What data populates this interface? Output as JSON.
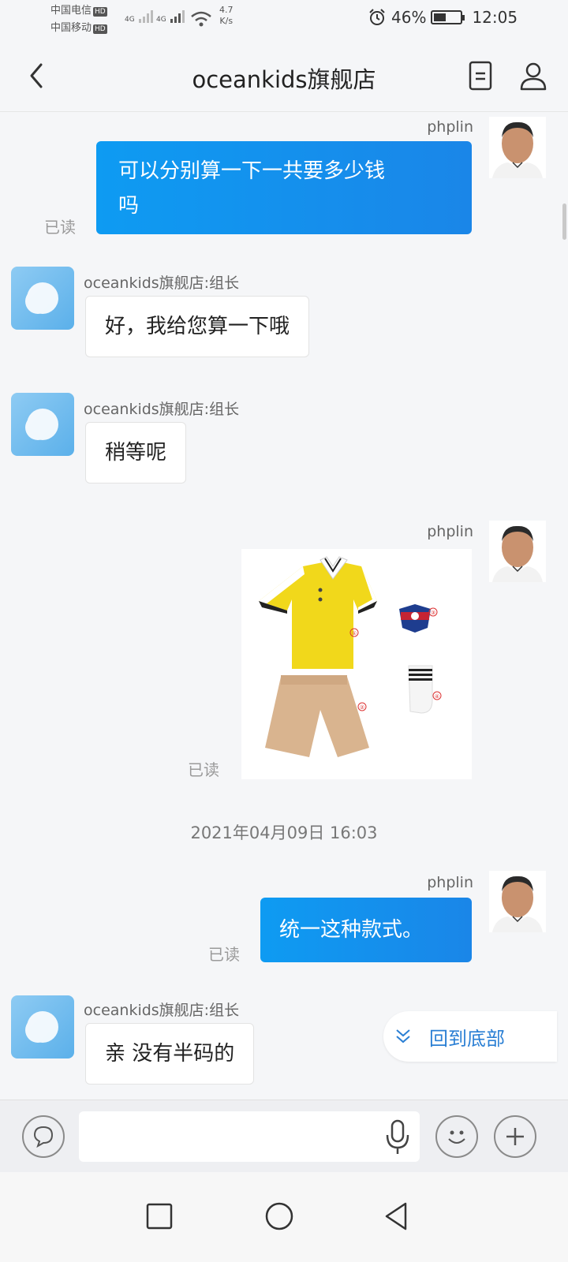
{
  "status_bar": {
    "carrier1": "中国电信",
    "carrier2": "中国移动",
    "hd": "HD",
    "net_type": "4G",
    "net_speed_value": "4.7",
    "net_speed_unit": "K/s",
    "battery_percent": "46%",
    "battery_level": 0.46,
    "time": "12:05"
  },
  "header": {
    "title": "oceankids旗舰店"
  },
  "messages": [
    {
      "sender": "phplin",
      "text_line1": "可以分别算一下一共要多少钱",
      "text_line2": "吗",
      "read": "已读"
    },
    {
      "sender": "oceankids旗舰店:组长",
      "text": "好，我给您算一下哦"
    },
    {
      "sender": "oceankids旗舰店:组长",
      "text": "稍等呢"
    },
    {
      "sender": "phplin",
      "read": "已读",
      "image_labels": [
        "①",
        "②",
        "③",
        "④"
      ]
    },
    {
      "timestamp": "2021年04月09日 16:03"
    },
    {
      "sender": "phplin",
      "text": "统一这种款式。",
      "read": "已读"
    },
    {
      "sender": "oceankids旗舰店:组长",
      "text": "亲 没有半码的"
    }
  ],
  "back_to_bottom": "回到底部",
  "icons": {
    "back": "chevron-left-icon",
    "doc": "document-icon",
    "profile": "person-icon",
    "voice": "speech-bubble-icon",
    "mic": "microphone-icon",
    "emoji": "smiley-icon",
    "plus": "plus-icon",
    "nav_recent": "square-icon",
    "nav_home": "circle-icon",
    "nav_back": "triangle-back-icon"
  }
}
